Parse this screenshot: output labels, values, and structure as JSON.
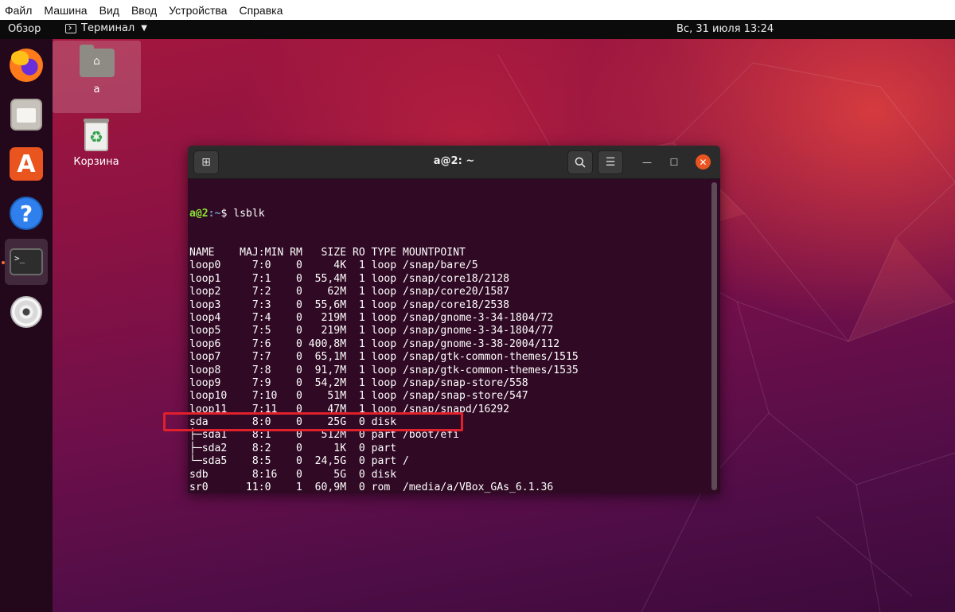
{
  "vbox_menu": [
    "Файл",
    "Машина",
    "Вид",
    "Ввод",
    "Устройства",
    "Справка"
  ],
  "topbar": {
    "activities": "Обзор",
    "app_name": "Терминал",
    "clock": "Вс, 31 июля  13:24"
  },
  "dock": {
    "items": [
      {
        "name": "firefox-icon"
      },
      {
        "name": "files-icon"
      },
      {
        "name": "software-store-icon"
      },
      {
        "name": "help-icon"
      },
      {
        "name": "terminal-icon",
        "glyph": ">_"
      },
      {
        "name": "dvd-icon"
      }
    ]
  },
  "desktop": {
    "home_label": "a",
    "trash_label": "Корзина"
  },
  "terminal": {
    "title": "a@2: ~",
    "prompt_user": "a@2",
    "prompt_path": ":~",
    "prompt_symbol": "$ ",
    "command": "lsblk",
    "output": [
      "NAME    MAJ:MIN RM   SIZE RO TYPE MOUNTPOINT",
      "loop0     7:0    0     4K  1 loop /snap/bare/5",
      "loop1     7:1    0  55,4M  1 loop /snap/core18/2128",
      "loop2     7:2    0    62M  1 loop /snap/core20/1587",
      "loop3     7:3    0  55,6M  1 loop /snap/core18/2538",
      "loop4     7:4    0   219M  1 loop /snap/gnome-3-34-1804/72",
      "loop5     7:5    0   219M  1 loop /snap/gnome-3-34-1804/77",
      "loop6     7:6    0 400,8M  1 loop /snap/gnome-3-38-2004/112",
      "loop7     7:7    0  65,1M  1 loop /snap/gtk-common-themes/1515",
      "loop8     7:8    0  91,7M  1 loop /snap/gtk-common-themes/1535",
      "loop9     7:9    0  54,2M  1 loop /snap/snap-store/558",
      "loop10    7:10   0    51M  1 loop /snap/snap-store/547",
      "loop11    7:11   0    47M  1 loop /snap/snapd/16292",
      "sda       8:0    0    25G  0 disk",
      "├─sda1    8:1    0   512M  0 part /boot/efi",
      "├─sda2    8:2    0     1K  0 part",
      "└─sda5    8:5    0  24,5G  0 part /",
      "sdb       8:16   0     5G  0 disk",
      "sr0      11:0    1  60,9M  0 rom  /media/a/VBox_GAs_6.1.36"
    ]
  },
  "annotation": {
    "color": "#e0202a"
  }
}
